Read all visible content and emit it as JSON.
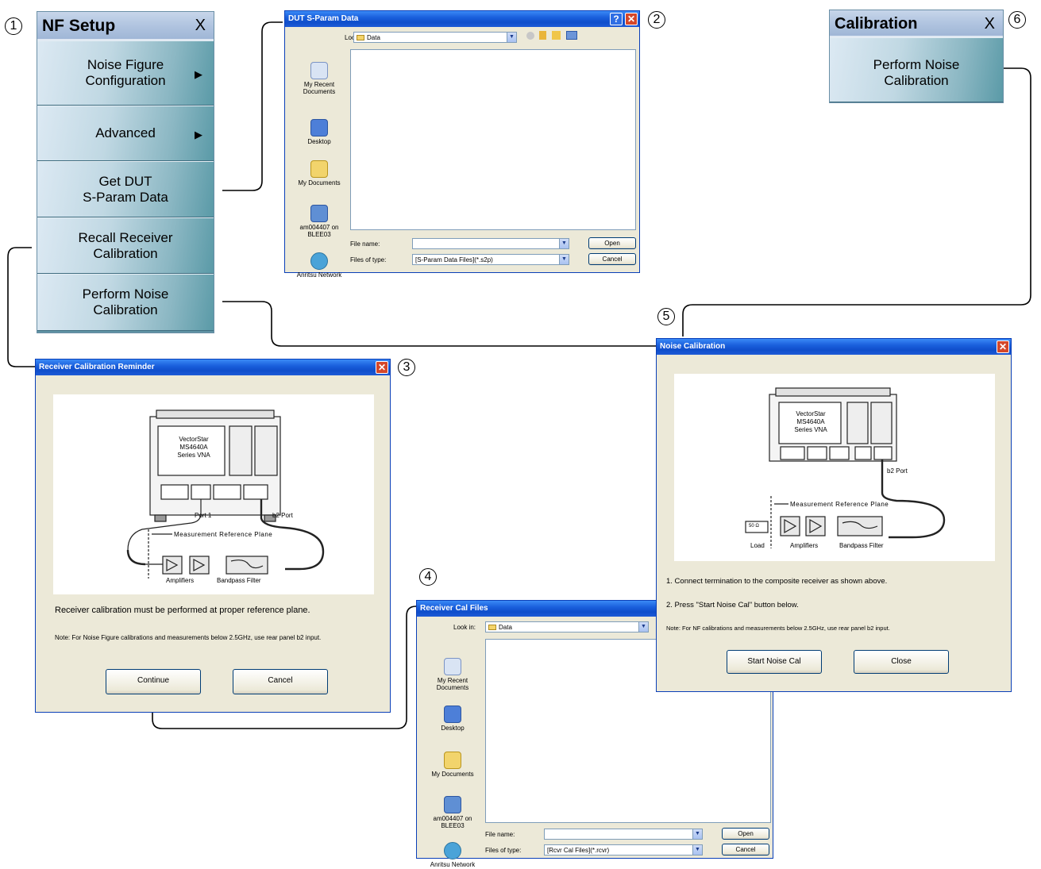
{
  "callouts": [
    "1",
    "2",
    "3",
    "4",
    "5",
    "6"
  ],
  "nf_setup": {
    "title": "NF Setup",
    "close": "X",
    "buttons": [
      {
        "label": "Noise Figure\nConfiguration",
        "arrow": "▶"
      },
      {
        "label": "Advanced",
        "arrow": "▶"
      },
      {
        "label": "Get DUT\nS-Param Data",
        "arrow": ""
      },
      {
        "label": "Recall Receiver\nCalibration",
        "arrow": ""
      },
      {
        "label": "Perform Noise\nCalibration",
        "arrow": ""
      }
    ]
  },
  "calibration_menu": {
    "title": "Calibration",
    "close": "X",
    "button": "Perform Noise\nCalibration"
  },
  "dut_dialog": {
    "title": "DUT S-Param Data",
    "help": "?",
    "close": "✕",
    "look_in_label": "Look in:",
    "look_in_value": "Data",
    "places": [
      "My Recent\nDocuments",
      "Desktop",
      "My Documents",
      "am004407 on\nBLEE03",
      "Anritsu Network"
    ],
    "file_name_label": "File name:",
    "file_name_value": "",
    "files_of_type_label": "Files of type:",
    "files_of_type_value": "[S-Param Data Files](*.s2p)",
    "open": "Open",
    "cancel": "Cancel"
  },
  "rcvr_reminder": {
    "title": "Receiver Calibration Reminder",
    "close": "✕",
    "diagram": {
      "vna": "VectorStar\nMS4640A\nSeries VNA",
      "port1": "Port 1",
      "b2port": "b2 Port",
      "ref_plane": "Measurement Reference Plane",
      "amplifiers": "Amplifiers",
      "bandpass": "Bandpass Filter"
    },
    "message": "Receiver calibration must be performed at proper reference plane.",
    "note": "Note: For Noise Figure calibrations and measurements below 2.5GHz, use rear panel b2 input.",
    "continue": "Continue",
    "cancel": "Cancel"
  },
  "rcvr_files": {
    "title": "Receiver Cal Files",
    "look_in_label": "Look in:",
    "look_in_value": "Data",
    "places": [
      "My Recent\nDocuments",
      "Desktop",
      "My Documents",
      "am004407 on\nBLEE03",
      "Anritsu Network"
    ],
    "file_name_label": "File name:",
    "file_name_value": "",
    "files_of_type_label": "Files of type:",
    "files_of_type_value": "[Rcvr Cal Files](*.rcvr)",
    "open": "Open",
    "cancel": "Cancel"
  },
  "noise_cal": {
    "title": "Noise Calibration",
    "close": "✕",
    "diagram": {
      "vna": "VectorStar\nMS4640A\nSeries VNA",
      "b2port": "b2 Port",
      "ref_plane": "Measurement Reference Plane",
      "load_box": "50 Ω",
      "load": "Load",
      "amplifiers": "Amplifiers",
      "bandpass": "Bandpass Filter"
    },
    "step1": "1. Connect termination to the composite receiver as shown above.",
    "step2": "2. Press \"Start Noise Cal\" button below.",
    "note": "Note: For NF calibrations and measurements below 2.5GHz, use rear panel b2 input.",
    "start": "Start Noise Cal",
    "close_btn": "Close"
  }
}
